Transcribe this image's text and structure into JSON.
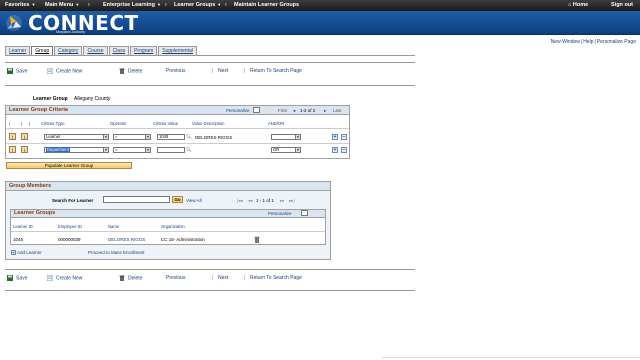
{
  "topnav": {
    "favorites": "Favorites",
    "main_menu": "Main Menu",
    "crumb1": "Enterprise Learning",
    "crumb2": "Learner Groups",
    "crumb3": "Maintain Learner Groups",
    "home": "Home",
    "signout": "Sign out"
  },
  "banner": {
    "title": "CONNECT",
    "subtitle": "Maryland Judiciary"
  },
  "links": {
    "new_window": "New Window",
    "help": "Help",
    "personalize": "Personalize Page"
  },
  "tabs": [
    "Learner",
    "Group",
    "Category",
    "Course",
    "Class",
    "Program",
    "Supplemental"
  ],
  "active_tab": 1,
  "actions": {
    "save": "Save",
    "create_new": "Create New",
    "delete": "Delete",
    "previous": "Previous",
    "next": "Next",
    "return": "Return To Search Page"
  },
  "learner_group": {
    "label": "Learner Group",
    "value": "Allegany County"
  },
  "criteria": {
    "title": "Learner Group Criteria",
    "personalize": "Personalize",
    "first": "First",
    "range": "1-2 of 2",
    "last": "Last",
    "headers": [
      "(",
      ")",
      "Criteria Type",
      "Operator",
      "Criteria Value",
      "Value Description",
      "AND/OR"
    ],
    "rows": [
      {
        "type": "Learner",
        "op": "=",
        "value": "1045",
        "desc": "DELORES RIGGS",
        "andor": ""
      },
      {
        "type": "Department",
        "op": "=",
        "value": "",
        "desc": "",
        "andor": "OR"
      }
    ],
    "populate": "Populate Learner Group"
  },
  "members": {
    "title": "Group Members",
    "search_label": "Search For Learner",
    "go": "Go",
    "view_all": "View All",
    "range": "1 - 1 of 1",
    "sub_title": "Learner Groups",
    "personalize": "Personalize",
    "headers": [
      "Learner ID",
      "Employee ID",
      "Name",
      "Organization"
    ],
    "rows": [
      {
        "learner_id": "1045",
        "employee_id": "000000039",
        "name": "DELORES RIGGS",
        "org": "CC 15- Administration"
      }
    ],
    "add": "Add Learner",
    "mass": "Proceed to Mass Enrollment"
  }
}
